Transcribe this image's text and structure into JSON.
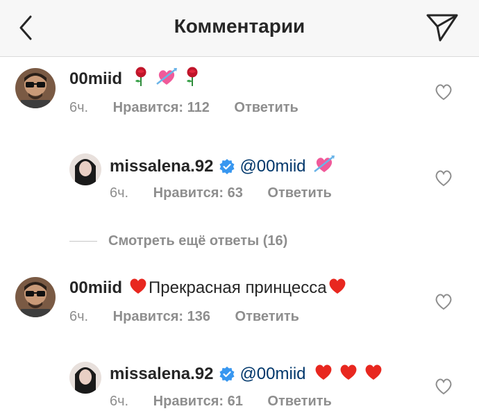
{
  "header": {
    "title": "Комментарии",
    "back_icon": "chevron-left-icon",
    "send_icon": "paper-plane-icon"
  },
  "comments": [
    {
      "username": "00miid",
      "text": "",
      "emojis": [
        "rose",
        "heart-with-arrow",
        "rose"
      ],
      "time": "6ч.",
      "likes": "Нравится: 112",
      "reply": "Ответить"
    },
    {
      "username": "missalena.92",
      "verified": true,
      "mention": "@00miid",
      "emojis": [
        "heart-with-arrow"
      ],
      "time": "6ч.",
      "likes": "Нравится: 63",
      "reply": "Ответить"
    },
    {
      "username": "00miid",
      "text": "Прекрасная принцесса",
      "emojis": [
        "red-heart",
        "red-heart"
      ],
      "time": "6ч.",
      "likes": "Нравится: 136",
      "reply": "Ответить"
    },
    {
      "username": "missalena.92",
      "verified": true,
      "mention": "@00miid",
      "emojis": [
        "red-heart",
        "red-heart",
        "red-heart"
      ],
      "time": "6ч.",
      "likes": "Нравится: 61",
      "reply": "Ответить"
    }
  ],
  "more_replies": "Смотреть ещё ответы (16)",
  "colors": {
    "text": "#262626",
    "meta": "#8e8e8e",
    "mention": "#00376b",
    "verified": "#3897f0",
    "header_bg": "#f7f7f7"
  }
}
